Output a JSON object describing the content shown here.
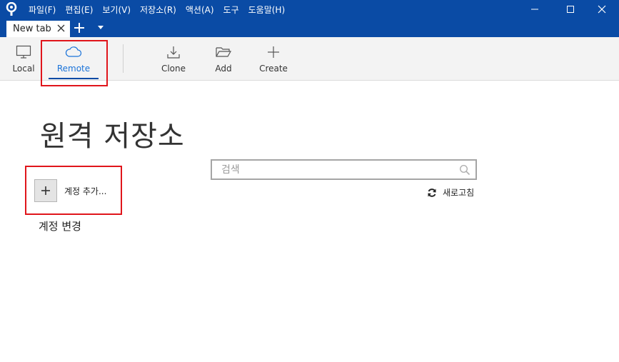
{
  "menu": [
    "파일(F)",
    "편집(E)",
    "보기(V)",
    "저장소(R)",
    "액션(A)",
    "도구",
    "도움말(H)"
  ],
  "tab": {
    "label": "New tab"
  },
  "toolbar": {
    "local": "Local",
    "remote": "Remote",
    "clone": "Clone",
    "add": "Add",
    "create": "Create"
  },
  "main": {
    "title": "원격 저장소",
    "add_account": "계정 추가...",
    "switch_account": "계정 변경",
    "search_placeholder": "검색",
    "refresh": "새로고침"
  },
  "colors": {
    "titlebar": "#0a4ba5",
    "highlight": "#e0151b",
    "remote_active": "#1a73d9"
  }
}
